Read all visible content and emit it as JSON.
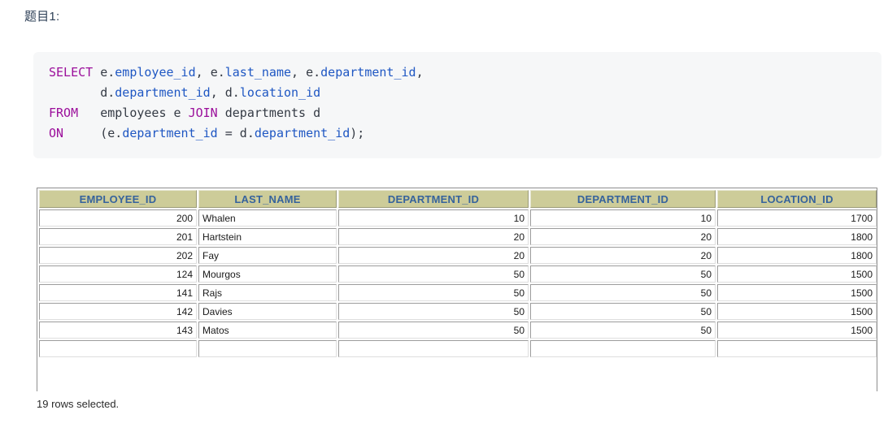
{
  "page": {
    "question_title": "题目1:",
    "rows_selected_text": "19 rows selected."
  },
  "sql": {
    "lines": [
      [
        {
          "t": "SELECT",
          "c": "kw"
        },
        {
          "t": " ",
          "c": "plain"
        },
        {
          "t": "e.",
          "c": "plain"
        },
        {
          "t": "employee_id",
          "c": "ident"
        },
        {
          "t": ", ",
          "c": "plain"
        },
        {
          "t": "e.",
          "c": "plain"
        },
        {
          "t": "last_name",
          "c": "ident"
        },
        {
          "t": ", ",
          "c": "plain"
        },
        {
          "t": "e.",
          "c": "plain"
        },
        {
          "t": "department_id",
          "c": "ident"
        },
        {
          "t": ",",
          "c": "plain"
        }
      ],
      [
        {
          "t": "       ",
          "c": "plain"
        },
        {
          "t": "d.",
          "c": "plain"
        },
        {
          "t": "department_id",
          "c": "ident"
        },
        {
          "t": ", ",
          "c": "plain"
        },
        {
          "t": "d.",
          "c": "plain"
        },
        {
          "t": "location_id",
          "c": "ident"
        }
      ],
      [
        {
          "t": "FROM",
          "c": "kw"
        },
        {
          "t": "   employees e ",
          "c": "plain"
        },
        {
          "t": "JOIN",
          "c": "kw"
        },
        {
          "t": " departments d",
          "c": "plain"
        }
      ],
      [
        {
          "t": "ON",
          "c": "kw"
        },
        {
          "t": "     (e.",
          "c": "plain"
        },
        {
          "t": "department_id",
          "c": "ident"
        },
        {
          "t": " = d.",
          "c": "plain"
        },
        {
          "t": "department_id",
          "c": "ident"
        },
        {
          "t": ");",
          "c": "plain"
        }
      ]
    ],
    "raw_text": "SELECT e.employee_id, e.last_name, e.department_id,\n       d.department_id, d.location_id\nFROM   employees e JOIN departments d\nON     (e.department_id = d.department_id);"
  },
  "result_grid": {
    "columns": [
      {
        "label": "EMPLOYEE_ID",
        "align": "num"
      },
      {
        "label": "LAST_NAME",
        "align": "txt"
      },
      {
        "label": "DEPARTMENT_ID",
        "align": "num"
      },
      {
        "label": "DEPARTMENT_ID",
        "align": "num"
      },
      {
        "label": "LOCATION_ID",
        "align": "num"
      }
    ],
    "rows": [
      [
        "200",
        "Whalen",
        "10",
        "10",
        "1700"
      ],
      [
        "201",
        "Hartstein",
        "20",
        "20",
        "1800"
      ],
      [
        "202",
        "Fay",
        "20",
        "20",
        "1800"
      ],
      [
        "124",
        "Mourgos",
        "50",
        "50",
        "1500"
      ],
      [
        "141",
        "Rajs",
        "50",
        "50",
        "1500"
      ],
      [
        "142",
        "Davies",
        "50",
        "50",
        "1500"
      ],
      [
        "143",
        "Matos",
        "50",
        "50",
        "1500"
      ],
      [
        "",
        "",
        "",
        "",
        ""
      ]
    ]
  },
  "colors": {
    "header_bg": "#cdcc99",
    "header_text": "#36639c",
    "code_bg": "#f6f7f8",
    "keyword": "#9b0f9b",
    "identifier": "#1f57c3",
    "title_text": "#2e4057"
  }
}
